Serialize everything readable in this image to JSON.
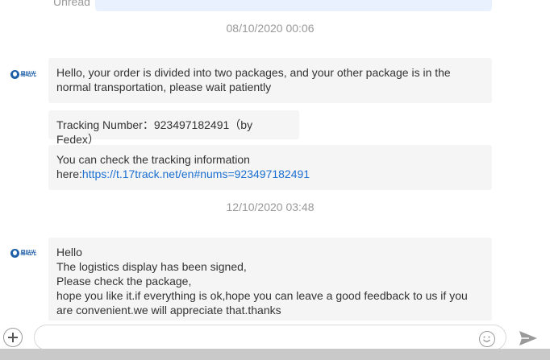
{
  "top": {
    "unread_label": "Unread"
  },
  "timestamps": [
    "08/10/2020 00:06",
    "12/10/2020 03:48"
  ],
  "agent": {
    "avatar_text": "易站光"
  },
  "messages": {
    "m1": "Hello, your order is divided into two packages, and your other package is in the normal transportation, please wait patiently",
    "m2": "Tracking Number：923497182491（by Fedex）",
    "m3_text": "You can check the tracking information here:",
    "m3_link": "https://t.17track.net/en#nums=923497182491",
    "m4_lines": [
      "Hello",
      "The logistics display has been signed,",
      "Please check the package,",
      "hope you like it.if everything is ok,hope you can leave a good feedback to us if you are convenient.we will appreciate that.thanks"
    ]
  },
  "composer": {
    "placeholder": "",
    "add_icon": "plus-icon",
    "emoji_icon": "smiley-icon",
    "send_icon": "send-icon"
  },
  "colors": {
    "bubble": "#f5f5f5",
    "link": "#1a6fd1",
    "timestamp": "#999999",
    "brand": "#1f5fa8"
  }
}
